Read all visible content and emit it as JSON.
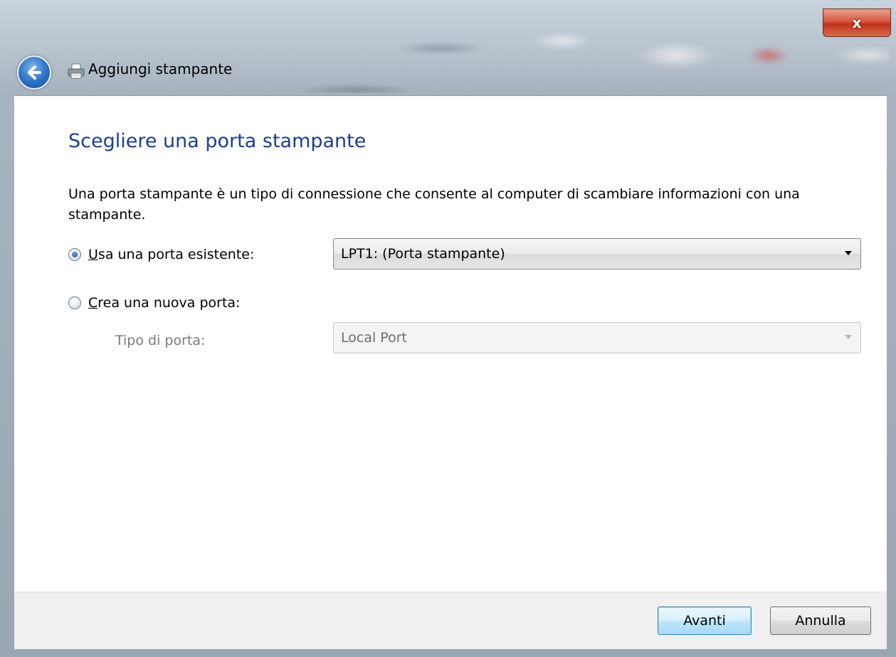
{
  "window": {
    "title": "Aggiungi stampante",
    "close_label": "x",
    "colors": {
      "heading": "#1e3f8a",
      "close": "#c0321a",
      "default_button": "#3c7fb1"
    }
  },
  "icons": {
    "back": "back-arrow-icon",
    "printer": "printer-icon",
    "close": "close-icon",
    "dropdown": "chevron-down-icon"
  },
  "content": {
    "heading": "Scegliere una porta stampante",
    "description": "Una porta stampante è un tipo di connessione che consente al computer di scambiare informazioni con una stampante.",
    "existing_port": {
      "label_accel": "U",
      "label_rest": "sa una porta esistente:",
      "selected": true,
      "value": "LPT1: (Porta stampante)"
    },
    "new_port": {
      "label_accel": "C",
      "label_rest": "rea una nuova porta:",
      "selected": false
    },
    "port_type": {
      "label": "Tipo di porta:",
      "value": "Local Port",
      "enabled": false
    }
  },
  "footer": {
    "next_label": "Avanti",
    "cancel_label": "Annulla"
  }
}
